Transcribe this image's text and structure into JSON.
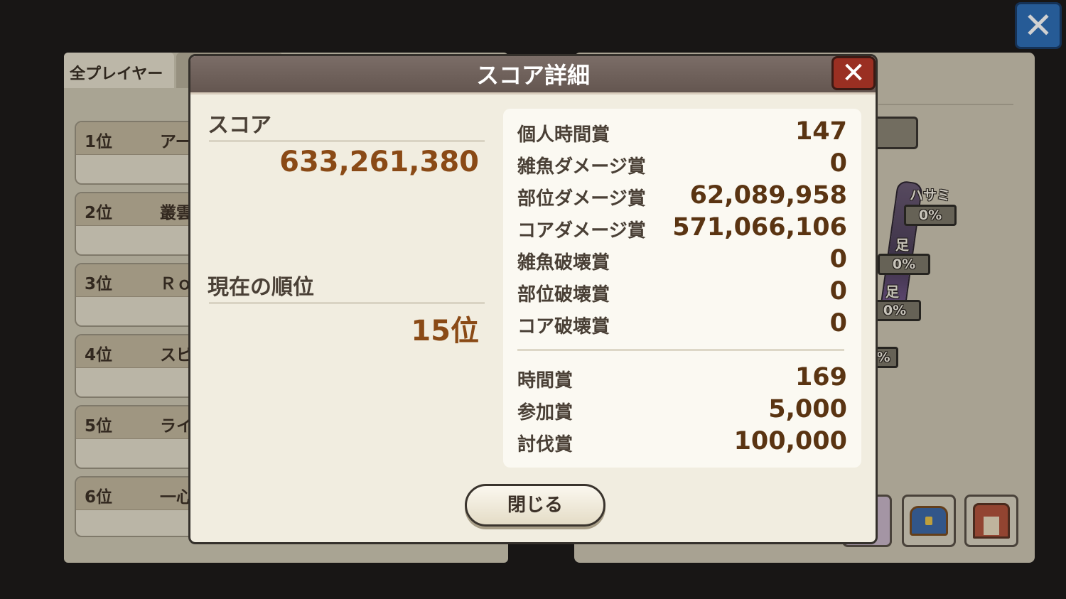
{
  "background": {
    "tab_active": "全プレイヤー",
    "ranking": [
      {
        "rank": "1位",
        "name": "アー"
      },
      {
        "rank": "2位",
        "name": "叢雲"
      },
      {
        "rank": "3位",
        "name": "Ｒｏ"
      },
      {
        "rank": "4位",
        "name": "スピ"
      },
      {
        "rank": "5位",
        "name": "ライ"
      },
      {
        "rank": "6位",
        "name": "一心"
      }
    ],
    "parts": [
      {
        "label": "ハサミ",
        "value": "0%"
      },
      {
        "label": "足",
        "value": "0%"
      },
      {
        "label": "足",
        "value": "0%"
      },
      {
        "label": "",
        "value": "%"
      }
    ],
    "close_icon": "close-icon",
    "icons": [
      "treasure-chest-icon",
      "shop-icon"
    ]
  },
  "modal": {
    "title": "スコア詳細",
    "close_symbol": "✕",
    "score_label": "スコア",
    "score_value": "633,261,380",
    "rank_label": "現在の順位",
    "rank_value": "15位",
    "details": [
      {
        "label": "個人時間賞",
        "value": "147"
      },
      {
        "label": "雑魚ダメージ賞",
        "value": "0"
      },
      {
        "label": "部位ダメージ賞",
        "value": "62,089,958"
      },
      {
        "label": "コアダメージ賞",
        "value": "571,066,106"
      },
      {
        "label": "雑魚破壊賞",
        "value": "0"
      },
      {
        "label": "部位破壊賞",
        "value": "0"
      },
      {
        "label": "コア破壊賞",
        "value": "0"
      }
    ],
    "bonuses": [
      {
        "label": "時間賞",
        "value": "169"
      },
      {
        "label": "参加賞",
        "value": "5,000"
      },
      {
        "label": "討伐賞",
        "value": "100,000"
      }
    ],
    "close_button": "閉じる"
  },
  "colors": {
    "accent_value": "#8a4a16",
    "header": "#6f625c",
    "close_red": "#9a2f22",
    "close_blue": "#2f6fb8"
  }
}
